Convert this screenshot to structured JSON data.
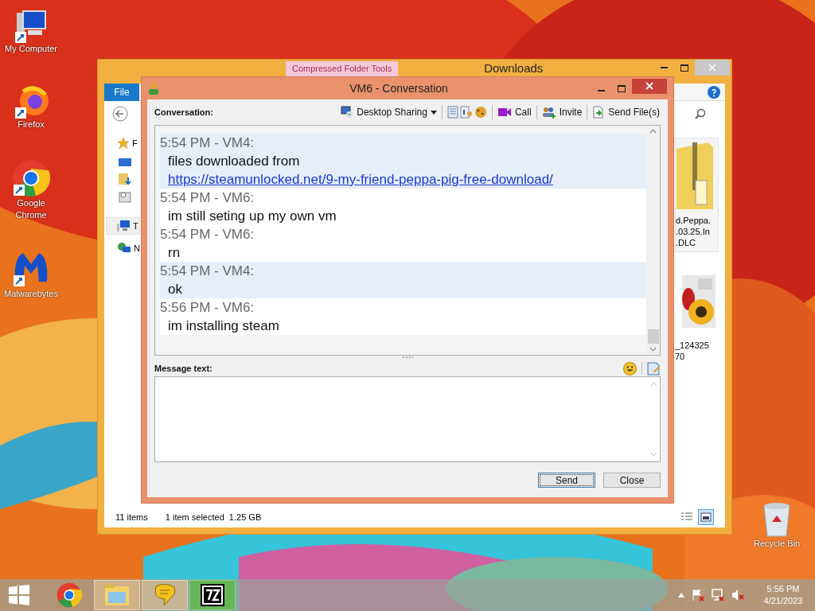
{
  "desktop_icons": [
    {
      "label": "My Computer",
      "kind": "computer"
    },
    {
      "label": "Firefox",
      "kind": "firefox"
    },
    {
      "label": "Google Chrome",
      "kind": "chrome"
    },
    {
      "label": "Malwarebytes",
      "kind": "malwarebytes"
    },
    {
      "label": "Recycle Bin",
      "kind": "recycle"
    }
  ],
  "explorer": {
    "title": "Downloads",
    "context_tab": "Compressed Folder Tools",
    "ribbon_tab": "File",
    "nav_items": [
      {
        "label": "F",
        "kind": "favorites",
        "selected": false
      },
      {
        "label": "T",
        "kind": "pc",
        "selected": true
      },
      {
        "label": "N",
        "kind": "network",
        "selected": false
      }
    ],
    "files": [
      {
        "label": "d.Peppa.\n.03.25.In\n.DLC",
        "kind": "zip",
        "selected": true
      },
      {
        "label": "_124325\n70",
        "selected": false
      }
    ],
    "status_items": "11 items",
    "status_selection": "1 item selected  1.25 GB",
    "views": [
      {
        "kind": "details",
        "selected": false
      },
      {
        "kind": "large",
        "selected": true
      }
    ]
  },
  "conversation": {
    "title": "VM6 - Conversation",
    "label": "Conversation:",
    "toolbar": [
      {
        "kind": "sharing",
        "label": "Desktop Sharing",
        "dropdown": true
      },
      {
        "kind": "notes"
      },
      {
        "kind": "info"
      },
      {
        "kind": "cookie"
      },
      {
        "kind": "call",
        "label": "Call"
      },
      {
        "kind": "invite",
        "label": "Invite"
      },
      {
        "kind": "file",
        "label": "Send File(s)"
      }
    ],
    "messages": [
      {
        "header": "5:54 PM - VM4:",
        "text": "files downloaded from ",
        "link": "https://steamunlocked.net/9-my-friend-peppa-pig-free-download/",
        "highlighted": true
      },
      {
        "header": "5:54 PM - VM6:",
        "text": "im still seting up my own vm",
        "highlighted": false
      },
      {
        "header": "5:54 PM - VM6:",
        "text": "rn",
        "highlighted": false
      },
      {
        "header": "5:54 PM - VM4:",
        "text": "ok",
        "highlighted": true
      },
      {
        "header": "5:56 PM - VM6:",
        "text": "im installing steam",
        "highlighted": false
      }
    ],
    "message_label": "Message text:",
    "buttons": [
      {
        "label": "Send",
        "default": true
      },
      {
        "label": "Close",
        "default": false
      }
    ]
  },
  "taskbar": {
    "apps": [
      {
        "kind": "chrome",
        "active": false
      },
      {
        "kind": "explorer",
        "active": true
      },
      {
        "kind": "chat",
        "active": true
      },
      {
        "kind": "sevenzip",
        "active": true
      }
    ],
    "time": "5:56 PM",
    "date": "4/21/2023"
  }
}
